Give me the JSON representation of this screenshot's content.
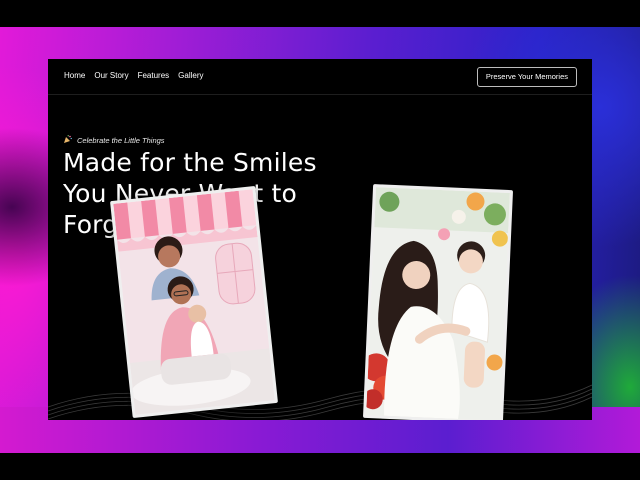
{
  "nav": {
    "links": [
      "Home",
      "Our Story",
      "Features",
      "Gallery"
    ],
    "cta_label": "Preserve Your Memories"
  },
  "hero": {
    "eyebrow_icon": "party-popper-icon",
    "eyebrow": "Celebrate the Little Things",
    "headline_lines": [
      "Made for the Smiles",
      "You Never Want to",
      "Forget"
    ]
  },
  "photos": [
    {
      "name": "family-photo",
      "subject": "family with baby under pink awning"
    },
    {
      "name": "mother-baby-photo",
      "subject": "mother holding baby among flowers"
    }
  ],
  "colors": {
    "page_bg": "#000000",
    "gradient_magenta": "#e21ad9",
    "gradient_purple": "#5b1ed0",
    "gradient_blue": "#2c22c8",
    "corner_green": "#1faa3a",
    "text": "#ffffff"
  }
}
